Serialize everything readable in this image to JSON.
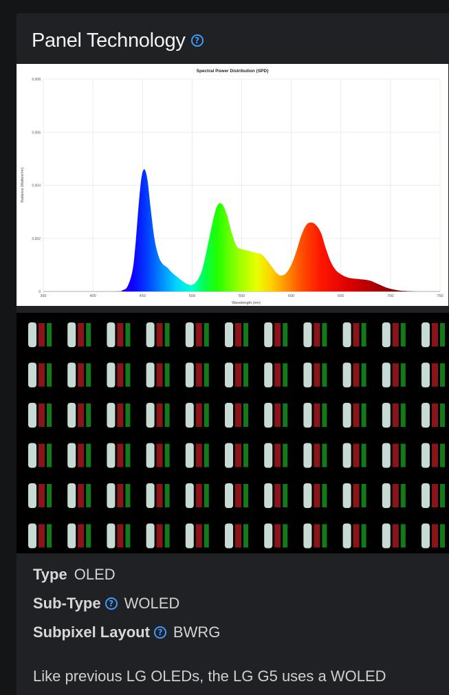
{
  "section": {
    "title": "Panel Technology",
    "help_icon": "question-circle-icon"
  },
  "chart_data": {
    "type": "area",
    "title": "Spectral Power Distribution (SPD)",
    "xlabel": "Wavelength (nm)",
    "ylabel": "Radiance (Watts/sr/m²)",
    "xlim": [
      350,
      750
    ],
    "ylim": [
      0,
      0.008
    ],
    "x_ticks": [
      "350",
      "400",
      "450",
      "500",
      "550",
      "600",
      "650",
      "700",
      "750"
    ],
    "y_ticks": [
      "0",
      "0.002",
      "0.004",
      "0.006",
      "0.008"
    ],
    "grid": true,
    "series": [
      {
        "x": [
          350,
          420,
          430,
          435,
          440,
          443,
          446,
          449,
          452,
          455,
          458,
          462,
          466,
          470,
          475,
          480,
          485,
          490,
          495,
          500,
          505,
          510,
          515,
          520,
          525,
          530,
          535,
          540,
          545,
          550,
          555,
          560,
          565,
          570,
          575,
          580,
          585,
          590,
          595,
          600,
          605,
          610,
          615,
          620,
          625,
          630,
          635,
          640,
          645,
          650,
          655,
          660,
          665,
          670,
          675,
          680,
          685,
          690,
          695,
          700,
          705,
          710,
          720,
          730,
          750
        ],
        "y": [
          0,
          0,
          5e-05,
          0.0002,
          0.0008,
          0.0018,
          0.0032,
          0.0043,
          0.0046,
          0.0042,
          0.0032,
          0.002,
          0.00135,
          0.00105,
          0.0009,
          0.0007,
          0.00055,
          0.0004,
          0.00028,
          0.00025,
          0.0004,
          0.0008,
          0.0016,
          0.0025,
          0.0032,
          0.0033,
          0.0029,
          0.0022,
          0.0017,
          0.0016,
          0.00155,
          0.0015,
          0.00145,
          0.0014,
          0.0012,
          0.00095,
          0.0007,
          0.0006,
          0.0007,
          0.001,
          0.0015,
          0.0021,
          0.0025,
          0.0026,
          0.0025,
          0.0022,
          0.0016,
          0.0011,
          0.0008,
          0.00065,
          0.00055,
          0.0005,
          0.00048,
          0.00046,
          0.00044,
          0.0004,
          0.00032,
          0.00024,
          0.00016,
          0.0001,
          6e-05,
          3e-05,
          1e-05,
          0,
          0
        ]
      }
    ]
  },
  "subpixel_image": {
    "icon": "subpixel-macro-photo",
    "rows": 6,
    "cols": 11,
    "colors": {
      "white": "#c7dad4",
      "red": "#8a1518",
      "green": "#127a18",
      "background": "#000000"
    }
  },
  "specs": {
    "type": {
      "label": "Type",
      "value": "OLED"
    },
    "subtype": {
      "label": "Sub-Type",
      "value": "WOLED"
    },
    "subpixel": {
      "label": "Subpixel Layout",
      "value": "BWRG"
    }
  },
  "description": {
    "line1": "Like previous LG OLEDs, the LG G5 uses a WOLED"
  },
  "colors": {
    "page_bg": "#141517",
    "card_bg": "#202124",
    "accent": "#3f9bff"
  }
}
